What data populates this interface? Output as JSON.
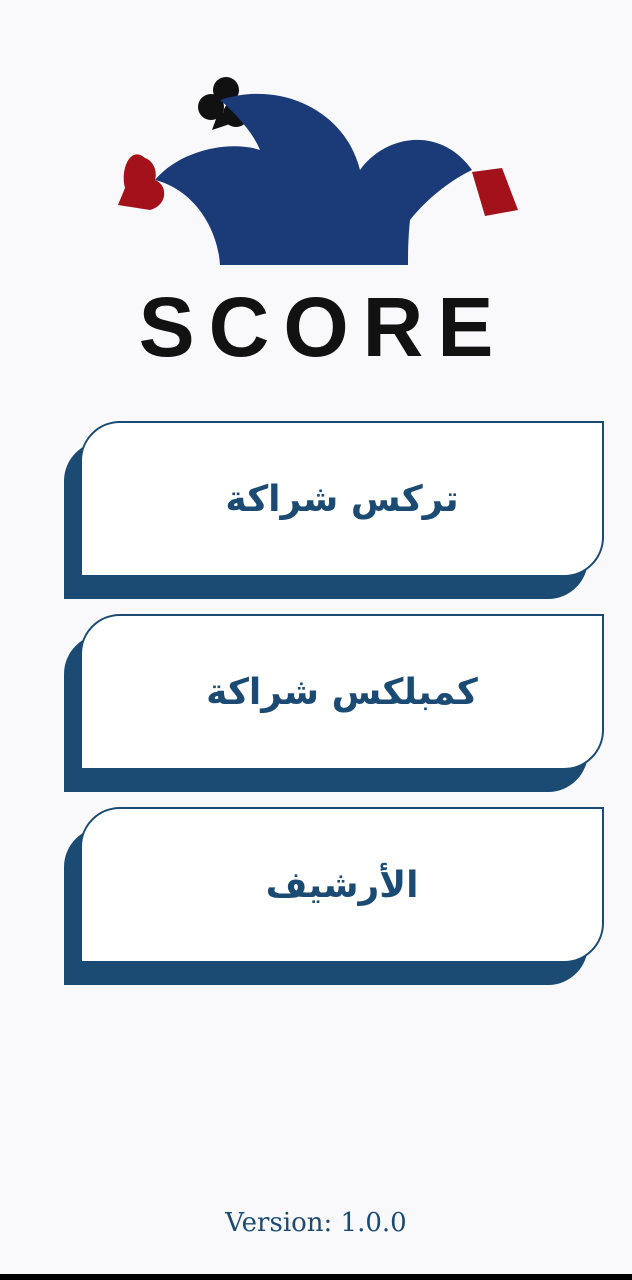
{
  "app": {
    "logo_text": "SCORE",
    "colors": {
      "brand_blue": "#1b4a72",
      "hat_blue": "#1a3a78",
      "accent_red": "#a3111a",
      "background": "#f9f9fc"
    }
  },
  "menu": {
    "items": [
      {
        "label": "تركس شراكة",
        "icon": "none"
      },
      {
        "label": "كمبلكس شراكة",
        "icon": "none"
      },
      {
        "label": "الأرشيف",
        "icon": "none"
      }
    ]
  },
  "footer": {
    "version_text": "Version: 1.0.0"
  }
}
